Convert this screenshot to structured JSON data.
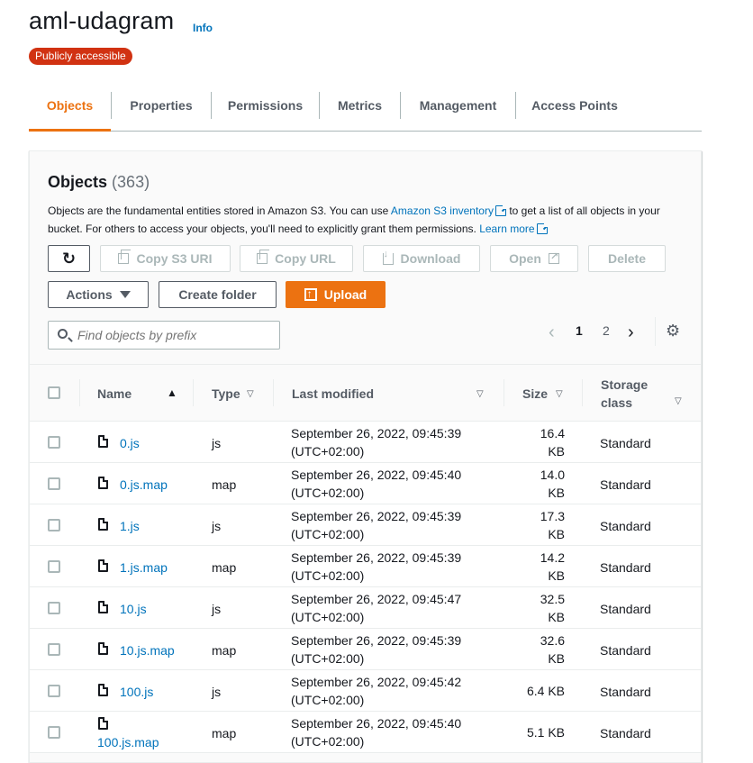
{
  "bucket": {
    "name": "aml-udagram",
    "info_label": "Info",
    "badge": "Publicly accessible"
  },
  "tabs": [
    "Objects",
    "Properties",
    "Permissions",
    "Metrics",
    "Management",
    "Access Points"
  ],
  "panel": {
    "title": "Objects",
    "count": "(363)",
    "desc_part1": "Objects are the fundamental entities stored in Amazon S3. You can use ",
    "desc_link1": "Amazon S3 inventory",
    "desc_part2": " to get a list of all objects in your bucket. For others to access your objects, you'll need to explicitly grant them permissions. ",
    "desc_link2": "Learn more"
  },
  "toolbar": {
    "copy_s3_uri": "Copy S3 URI",
    "copy_url": "Copy URL",
    "download": "Download",
    "open": "Open",
    "delete": "Delete",
    "actions": "Actions",
    "create_folder": "Create folder",
    "upload": "Upload"
  },
  "search": {
    "placeholder": "Find objects by prefix"
  },
  "pagination": {
    "page1": "1",
    "page2": "2"
  },
  "table": {
    "headers": {
      "name": "Name",
      "type": "Type",
      "last_modified": "Last modified",
      "size": "Size",
      "storage_line1": "Storage",
      "storage_line2": "class"
    },
    "rows": [
      {
        "name": "0.js",
        "type": "js",
        "mod1": "September 26, 2022, 09:45:39",
        "mod2": "(UTC+02:00)",
        "size1": "16.4",
        "size2": "KB",
        "storage": "Standard"
      },
      {
        "name": "0.js.map",
        "type": "map",
        "mod1": "September 26, 2022, 09:45:40",
        "mod2": "(UTC+02:00)",
        "size1": "14.0",
        "size2": "KB",
        "storage": "Standard"
      },
      {
        "name": "1.js",
        "type": "js",
        "mod1": "September 26, 2022, 09:45:39",
        "mod2": "(UTC+02:00)",
        "size1": "17.3",
        "size2": "KB",
        "storage": "Standard"
      },
      {
        "name": "1.js.map",
        "type": "map",
        "mod1": "September 26, 2022, 09:45:39",
        "mod2": "(UTC+02:00)",
        "size1": "14.2",
        "size2": "KB",
        "storage": "Standard"
      },
      {
        "name": "10.js",
        "type": "js",
        "mod1": "September 26, 2022, 09:45:47",
        "mod2": "(UTC+02:00)",
        "size1": "32.5",
        "size2": "KB",
        "storage": "Standard"
      },
      {
        "name": "10.js.map",
        "type": "map",
        "mod1": "September 26, 2022, 09:45:39",
        "mod2": "(UTC+02:00)",
        "size1": "32.6",
        "size2": "KB",
        "storage": "Standard"
      },
      {
        "name": "100.js",
        "type": "js",
        "mod1": "September 26, 2022, 09:45:42",
        "mod2": "(UTC+02:00)",
        "size1": "6.4 KB",
        "size2": "",
        "storage": "Standard"
      },
      {
        "name": "100.js.map",
        "type": "map",
        "mod1": "September 26, 2022, 09:45:40",
        "mod2": "(UTC+02:00)",
        "size1": "5.1 KB",
        "size2": "",
        "storage": "Standard"
      }
    ]
  },
  "colors": {
    "accent": "#ec7211",
    "link": "#0073bb",
    "badge": "#d13212"
  }
}
